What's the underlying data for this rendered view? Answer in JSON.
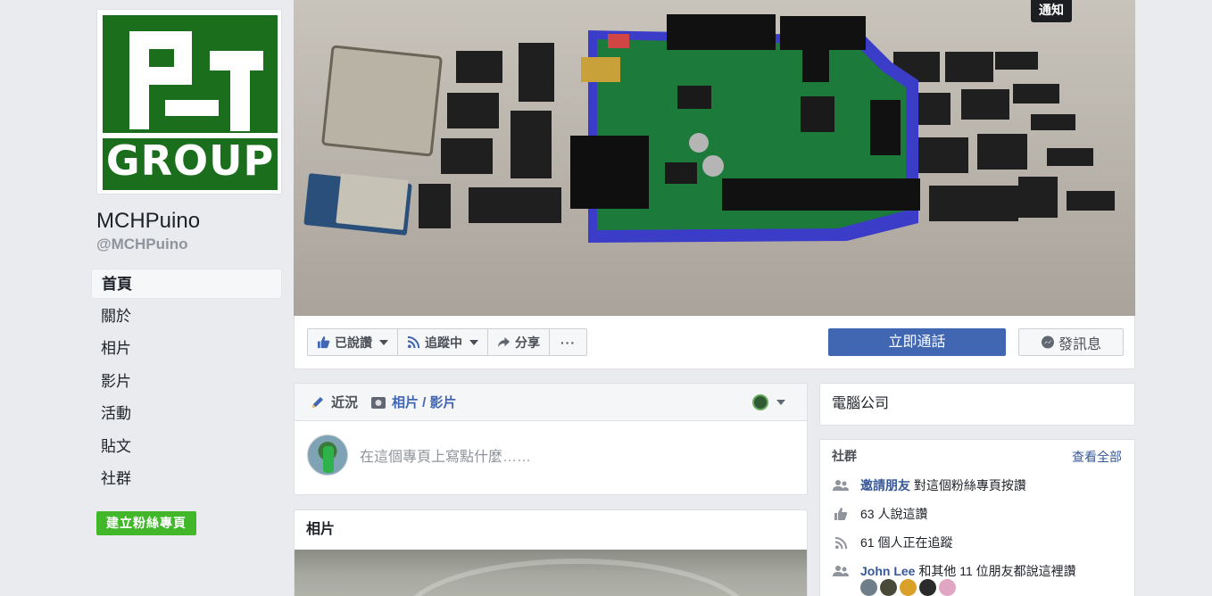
{
  "page": {
    "name": "MCHPuino",
    "handle": "@MCHPuino",
    "logo_word": "GROUP"
  },
  "nav": {
    "items": [
      "首頁",
      "關於",
      "相片",
      "影片",
      "活動",
      "貼文",
      "社群"
    ],
    "active_index": 0
  },
  "create_page_label": "建立粉絲專頁",
  "notice_label": "通知",
  "actions": {
    "liked": "已說讚",
    "following": "追蹤中",
    "share": "分享",
    "more": "···",
    "call": "立即通話",
    "message": "發訊息"
  },
  "composer": {
    "tab_status": "近況",
    "tab_photo": "相片 / 影片",
    "placeholder": "在這個專頁上寫點什麼……"
  },
  "photos": {
    "title": "相片"
  },
  "category": "電腦公司",
  "community": {
    "title": "社群",
    "see_all": "查看全部",
    "invite_link": "邀請朋友",
    "invite_text": "對這個粉絲專頁按讚",
    "likes_text": "63 人說這讚",
    "follows_text": "61 個人正在追蹤",
    "friends_link": "John Lee",
    "friends_text": "和其他 11 位朋友都說這裡讚"
  },
  "colors": {
    "brand_blue": "#4267b2",
    "link_blue": "#365899",
    "green": "#42b72a",
    "logo_green": "#1a6e1c"
  }
}
